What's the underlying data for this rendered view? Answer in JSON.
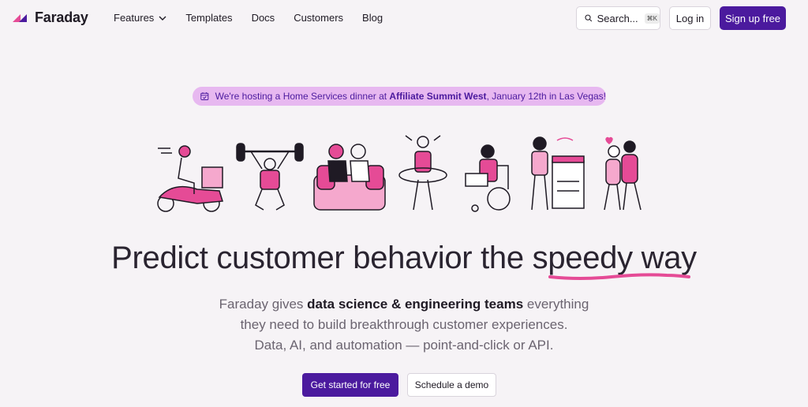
{
  "brand": {
    "name": "Faraday",
    "accent": "#4b1a9e",
    "pink": "#e54b96"
  },
  "nav": {
    "links": [
      "Features",
      "Templates",
      "Docs",
      "Customers",
      "Blog"
    ],
    "search_label": "Search...",
    "search_shortcut": "⌘K",
    "login_label": "Log in",
    "signup_label": "Sign up free"
  },
  "banner": {
    "prefix": "We're hosting a Home Services dinner at ",
    "bold": "Affiliate Summit West",
    "suffix": ", January 12th in Las Vegas!",
    "icon": "calendar-check-icon"
  },
  "hero": {
    "headline_pre": "Predict customer behavior the ",
    "headline_emph": "speedy way",
    "sub_pre": "Faraday gives ",
    "sub_bold": "data science & engineering teams",
    "sub_post_1": " everything",
    "sub_line2": "they need to build breakthrough customer experiences.",
    "sub_line3": "Data, AI, and automation — point-and-click or API.",
    "cta_primary": "Get started for free",
    "cta_secondary": "Schedule a demo"
  },
  "illustrations": [
    "scooter-delivery",
    "weightlifter",
    "couple-on-couch",
    "hula-hoop",
    "wheelchair-laptop",
    "copier-woman",
    "dancing-couple"
  ]
}
